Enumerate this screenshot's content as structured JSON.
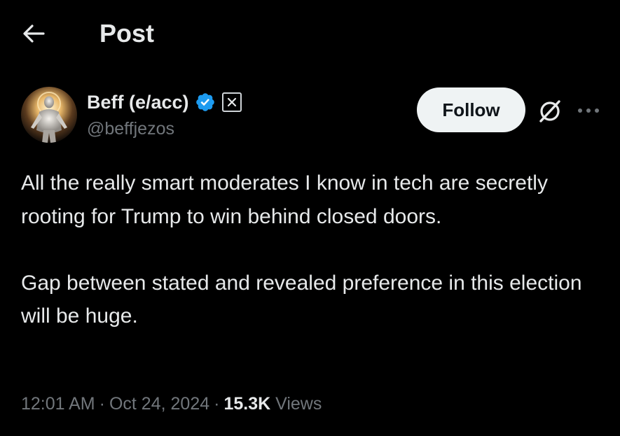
{
  "header": {
    "title": "Post",
    "back_icon": "arrow-left-icon"
  },
  "author": {
    "display_name": "Beff (e/acc)",
    "handle": "@beffjezos",
    "verified_icon": "verified-badge-icon",
    "affiliate_icon": "x-affiliate-badge-icon",
    "avatar": "avatar-glowing-figure"
  },
  "actions": {
    "follow_label": "Follow",
    "grok_icon": "grok-icon",
    "more_icon": "more-options-icon"
  },
  "tweet": {
    "paragraph_1": "All the really smart moderates I know in tech are secretly rooting for Trump to win behind closed doors.",
    "paragraph_2": "Gap between stated and revealed preference in this election will be huge."
  },
  "meta": {
    "time": "12:01 AM",
    "date": "Oct 24, 2024",
    "views_count": "15.3K",
    "views_label": "Views",
    "separator": "·"
  },
  "colors": {
    "background": "#000000",
    "text_primary": "#e7e9ea",
    "text_secondary": "#71767b",
    "verified_blue": "#1d9bf0",
    "follow_bg": "#eff3f4"
  }
}
